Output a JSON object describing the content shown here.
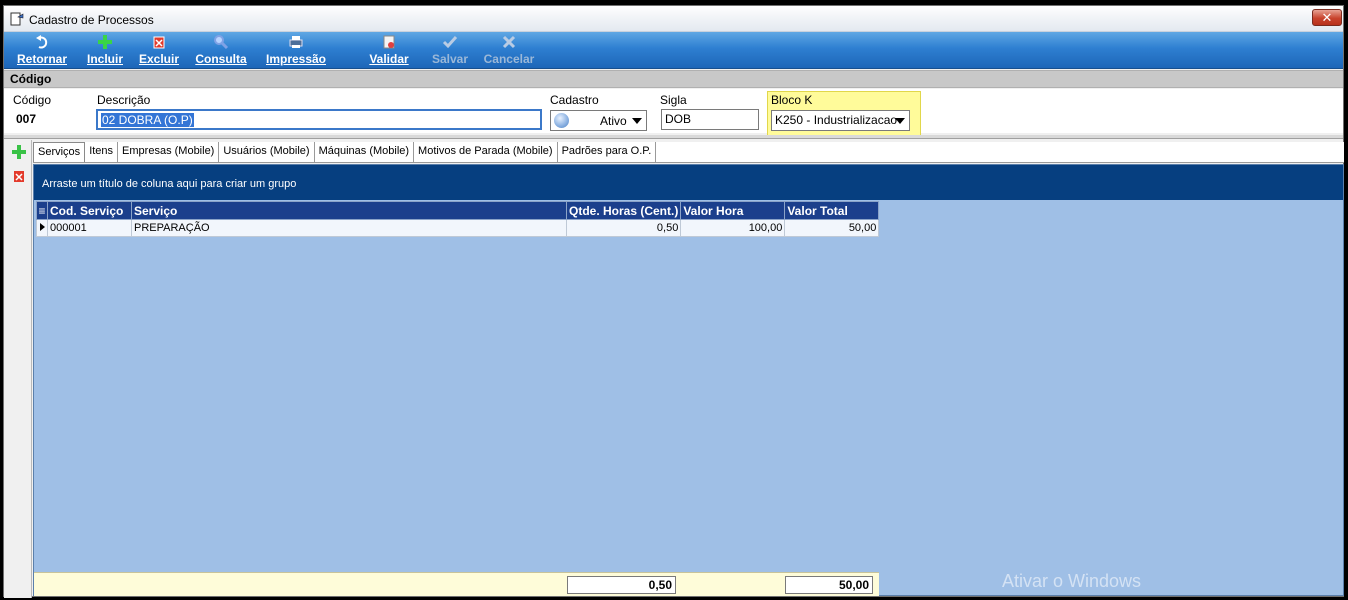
{
  "window": {
    "title": "Cadastro de Processos",
    "close_label": "✕"
  },
  "toolbar": {
    "buttons": [
      {
        "label": "Retornar",
        "icon": "return-icon"
      },
      {
        "label": "Incluir",
        "icon": "plus-icon"
      },
      {
        "label": "Excluir",
        "icon": "delete-icon"
      },
      {
        "label": "Consulta",
        "icon": "search-icon"
      },
      {
        "label": "Impressão",
        "icon": "printer-icon"
      },
      {
        "label": "Validar",
        "icon": "validate-icon"
      },
      {
        "label": "Salvar",
        "icon": "check-icon",
        "disabled": true
      },
      {
        "label": "Cancelar",
        "icon": "cancel-icon",
        "disabled": true
      }
    ]
  },
  "section": {
    "title": "Código"
  },
  "form": {
    "codigo_label": "Código",
    "codigo_value": "007",
    "descricao_label": "Descrição",
    "descricao_value": "02 DOBRA (O.P)",
    "cadastro_label": "Cadastro",
    "cadastro_value": "Ativo",
    "sigla_label": "Sigla",
    "sigla_value": "DOB",
    "bloco_label": "Bloco K",
    "bloco_value": "K250 - Industrializacao"
  },
  "tabs": [
    {
      "label": "Serviços",
      "active": true
    },
    {
      "label": "Itens"
    },
    {
      "label": "Empresas (Mobile)"
    },
    {
      "label": "Usuários (Mobile)"
    },
    {
      "label": "Máquinas (Mobile)"
    },
    {
      "label": "Motivos de Parada (Mobile)"
    },
    {
      "label": "Padrões para O.P."
    }
  ],
  "grid": {
    "group_hint": "Arraste um título de coluna aqui para criar um grupo",
    "columns": [
      "Cod. Serviço",
      "Serviço",
      "Qtde. Horas (Cent.)",
      "Valor Hora",
      "Valor Total"
    ],
    "rows": [
      {
        "cod": "000001",
        "servico": "PREPARAÇÃO",
        "qtde": "0,50",
        "valor_hora": "100,00",
        "valor_total": "50,00"
      }
    ],
    "footer": {
      "qtde_total": "0,50",
      "valor_total": "50,00"
    }
  },
  "watermark": "Ativar o Windows",
  "colors": {
    "toolbar": "#2e7fd1",
    "grid_bg": "#9fbfe6",
    "group_panel": "#063f80",
    "highlight": "#fffb9a"
  }
}
